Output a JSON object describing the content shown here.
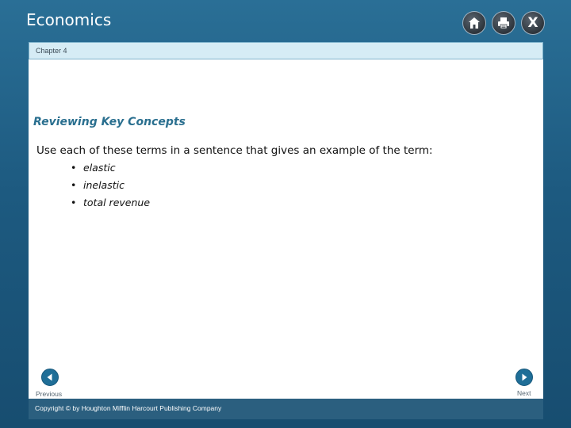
{
  "app": {
    "title": "Economics"
  },
  "toolbar": {
    "buttons": [
      {
        "icon": "home-icon"
      },
      {
        "icon": "print-icon"
      },
      {
        "icon": "close-icon",
        "label": "X"
      }
    ]
  },
  "header": {
    "chapter": "Chapter 4"
  },
  "main": {
    "heading": "Reviewing Key Concepts",
    "instruction": "Use each of these terms in a sentence that gives an example of the term:",
    "bullet": "•",
    "terms": [
      "elastic",
      "inelastic",
      "total revenue"
    ]
  },
  "nav": {
    "previous_label": "Previous",
    "next_label": "Next",
    "previous_icon": "left-arrow-icon",
    "next_icon": "right-arrow-icon"
  },
  "footer": {
    "copyright": "Copyright © by Houghton Mifflin Harcourt Publishing Company"
  },
  "colors": {
    "background": "#1d5a80",
    "subheader": "#d6ecf5",
    "heading": "#2a6f8f",
    "nav_button": "#1f6e97",
    "footer": "#2b5f7f"
  }
}
